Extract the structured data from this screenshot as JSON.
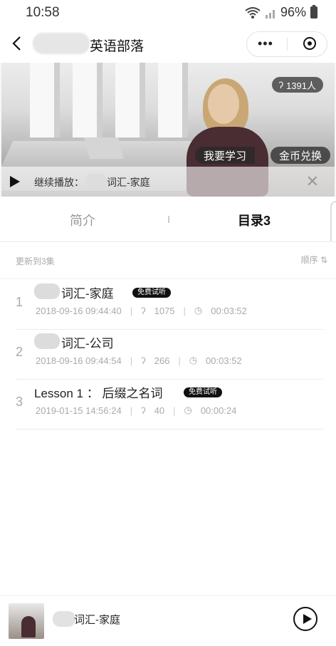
{
  "status_bar": {
    "time": "10:58",
    "battery": "96%"
  },
  "header": {
    "title": "英语部落"
  },
  "hero": {
    "listener_count": "1391人",
    "btn_learn": "我要学习",
    "btn_coin": "金币兑换",
    "continue_label": "继续播放：",
    "continue_title": "词汇-家庭"
  },
  "tabs": [
    {
      "label": "简介"
    },
    {
      "label": "目录3"
    }
  ],
  "meta": {
    "updated": "更新到3集",
    "order": "顺序"
  },
  "items": [
    {
      "index": "1",
      "title": "词汇-家庭",
      "free_badge": "免费试听",
      "date": "2018-09-16 09:44:40",
      "plays": "1075",
      "duration": "00:03:52"
    },
    {
      "index": "2",
      "title": "词汇-公司",
      "date": "2018-09-16 09:44:54",
      "plays": "266",
      "duration": "00:03:52"
    },
    {
      "index": "3",
      "title": "Lesson 1 ： 后缀之名词",
      "free_badge": "免费试听",
      "date": "2019-01-15 14:56:24",
      "plays": "40",
      "duration": "00:00:24"
    }
  ],
  "player": {
    "title": "词汇-家庭"
  }
}
